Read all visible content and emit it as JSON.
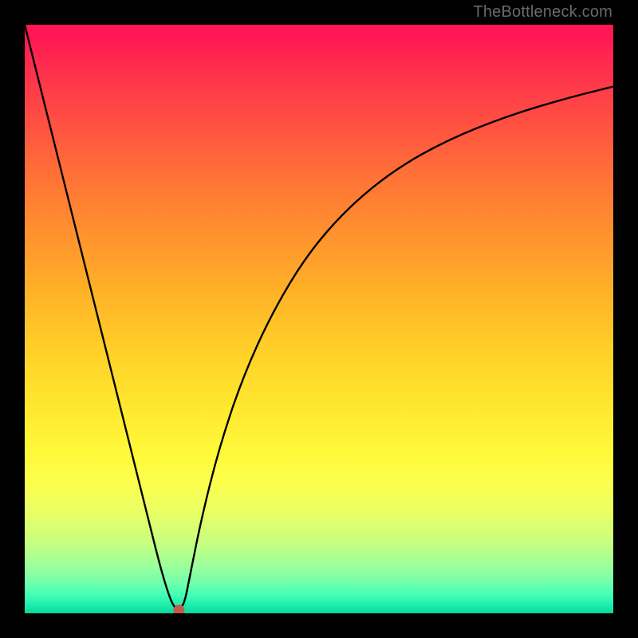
{
  "watermark": "TheBottleneck.com",
  "chart_data": {
    "type": "line",
    "title": "",
    "xlabel": "",
    "ylabel": "",
    "xlim": [
      0,
      100
    ],
    "ylim": [
      0,
      100
    ],
    "grid": false,
    "series": [
      {
        "name": "bottleneck-curve",
        "x": [
          0,
          3,
          6,
          9,
          12,
          15,
          18,
          21,
          23,
          24.5,
          25.5,
          26.5,
          27.2,
          28,
          30,
          33,
          37,
          42,
          48,
          55,
          63,
          72,
          82,
          92,
          100
        ],
        "y": [
          100,
          88,
          76,
          64,
          52,
          40,
          28,
          16,
          8,
          3,
          0.8,
          0.8,
          2,
          6,
          16,
          28,
          40,
          51,
          61,
          69,
          75.5,
          80.5,
          84.5,
          87.5,
          89.5
        ]
      }
    ],
    "marker": {
      "x": 26.2,
      "y": 0.5,
      "color": "#c55a4a",
      "radius_px": 7
    },
    "background_gradient": {
      "top": "#ff1655",
      "mid": "#ffd22a",
      "bottom": "#0ad79c"
    },
    "frame_color": "#000000"
  }
}
